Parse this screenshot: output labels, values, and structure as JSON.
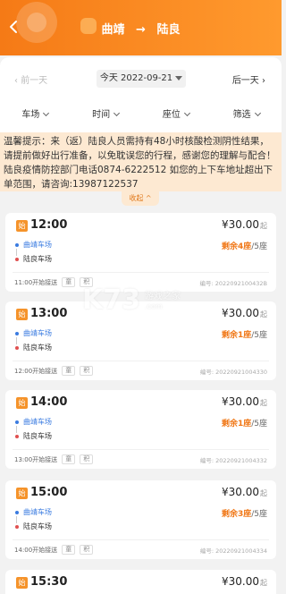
{
  "header": {
    "from": "曲靖",
    "arrow": "→",
    "to": "陆良",
    "colors": {
      "header_start": "#f57a16",
      "header_end": "#ff9a2e"
    }
  },
  "date_nav": {
    "prev_label": "前一天",
    "date_label": "今天 2022-09-21",
    "next_label": "后一天"
  },
  "filters": [
    {
      "label": "车场"
    },
    {
      "label": "时间"
    },
    {
      "label": "座位"
    },
    {
      "label": "筛选"
    }
  ],
  "notice": {
    "text": "温馨提示：来（返）陆良人员需持有48小时核酸检测阴性结果，请提前做好出行准备，以免耽误您的行程，感谢您的理解与配合！陆良疫情防控部门电话0874-6222512 如您的上下车地址超出下单范围，请咨询:13987122537",
    "collapse_label": "收起"
  },
  "trips": [
    {
      "start_tag": "始",
      "time": "12:00",
      "price": "¥30.00",
      "price_suffix": "起",
      "from": "曲靖车场",
      "to": "陆良车场",
      "seats_remaining": "剩余4座",
      "seats_total": "/5座",
      "pickup": "11:00开始接送",
      "tags": [
        "童",
        "积"
      ],
      "code": "编号: 2022092100432B"
    },
    {
      "start_tag": "始",
      "time": "13:00",
      "price": "¥30.00",
      "price_suffix": "起",
      "from": "曲靖车场",
      "to": "陆良车场",
      "seats_remaining": "剩余1座",
      "seats_total": "/5座",
      "pickup": "12:00开始接送",
      "tags": [
        "童",
        "积"
      ],
      "code": "编号: 20220921004330"
    },
    {
      "start_tag": "始",
      "time": "14:00",
      "price": "¥30.00",
      "price_suffix": "起",
      "from": "曲靖车场",
      "to": "陆良车场",
      "seats_remaining": "剩余1座",
      "seats_total": "/5座",
      "pickup": "13:00开始接送",
      "tags": [
        "童",
        "积"
      ],
      "code": "编号: 20220921004332"
    },
    {
      "start_tag": "始",
      "time": "15:00",
      "price": "¥30.00",
      "price_suffix": "起",
      "from": "曲靖车场",
      "to": "陆良车场",
      "seats_remaining": "剩余3座",
      "seats_total": "/5座",
      "pickup": "14:00开始接送",
      "tags": [
        "童",
        "积"
      ],
      "code": "编号: 20220921004334"
    },
    {
      "start_tag": "始",
      "time": "15:30",
      "price": "¥30.00",
      "price_suffix": "起",
      "from": "",
      "to": "",
      "seats_remaining": "",
      "seats_total": "",
      "pickup": "",
      "tags": [],
      "code": ""
    }
  ],
  "watermark": {
    "mark": "K73",
    "cn": "游戏之家",
    "url": ".com"
  }
}
